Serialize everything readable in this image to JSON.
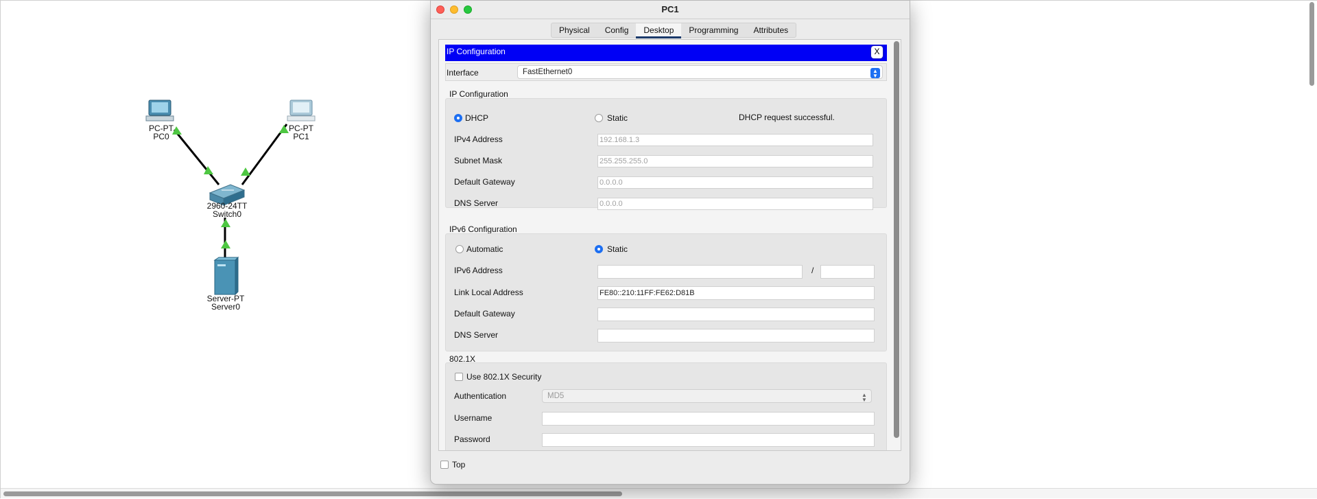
{
  "topology": {
    "pc0": {
      "type": "PC-PT",
      "name": "PC0"
    },
    "pc1": {
      "type": "PC-PT",
      "name": "PC1"
    },
    "switch0": {
      "type": "2960-24TT",
      "name": "Switch0"
    },
    "server0": {
      "type": "Server-PT",
      "name": "Server0"
    }
  },
  "dialog": {
    "title": "PC1",
    "tabs": [
      "Physical",
      "Config",
      "Desktop",
      "Programming",
      "Attributes"
    ],
    "active_tab": "Desktop"
  },
  "ip_config": {
    "header": "IP Configuration",
    "close_label": "X",
    "interface_label": "Interface",
    "interface_value": "FastEthernet0",
    "ipv4": {
      "section_title": "IP Configuration",
      "dhcp_label": "DHCP",
      "static_label": "Static",
      "status": "DHCP request successful.",
      "fields": [
        {
          "label": "IPv4 Address",
          "value": "192.168.1.3"
        },
        {
          "label": "Subnet Mask",
          "value": "255.255.255.0"
        },
        {
          "label": "Default Gateway",
          "value": "0.0.0.0"
        },
        {
          "label": "DNS Server",
          "value": "0.0.0.0"
        }
      ]
    },
    "ipv6": {
      "section_title": "IPv6 Configuration",
      "automatic_label": "Automatic",
      "static_label": "Static",
      "address_label": "IPv6 Address",
      "address_value": "",
      "slash": "/",
      "prefix_value": "",
      "link_local_label": "Link Local Address",
      "link_local_value": "FE80::210:11FF:FE62:D81B",
      "gateway_label": "Default Gateway",
      "gateway_value": "",
      "dns_label": "DNS Server",
      "dns_value": ""
    },
    "dot1x": {
      "section_title": "802.1X",
      "use_label": "Use 802.1X Security",
      "auth_label": "Authentication",
      "auth_value": "MD5",
      "username_label": "Username",
      "username_value": "",
      "password_label": "Password",
      "password_value": ""
    }
  },
  "footer": {
    "top_label": "Top"
  }
}
